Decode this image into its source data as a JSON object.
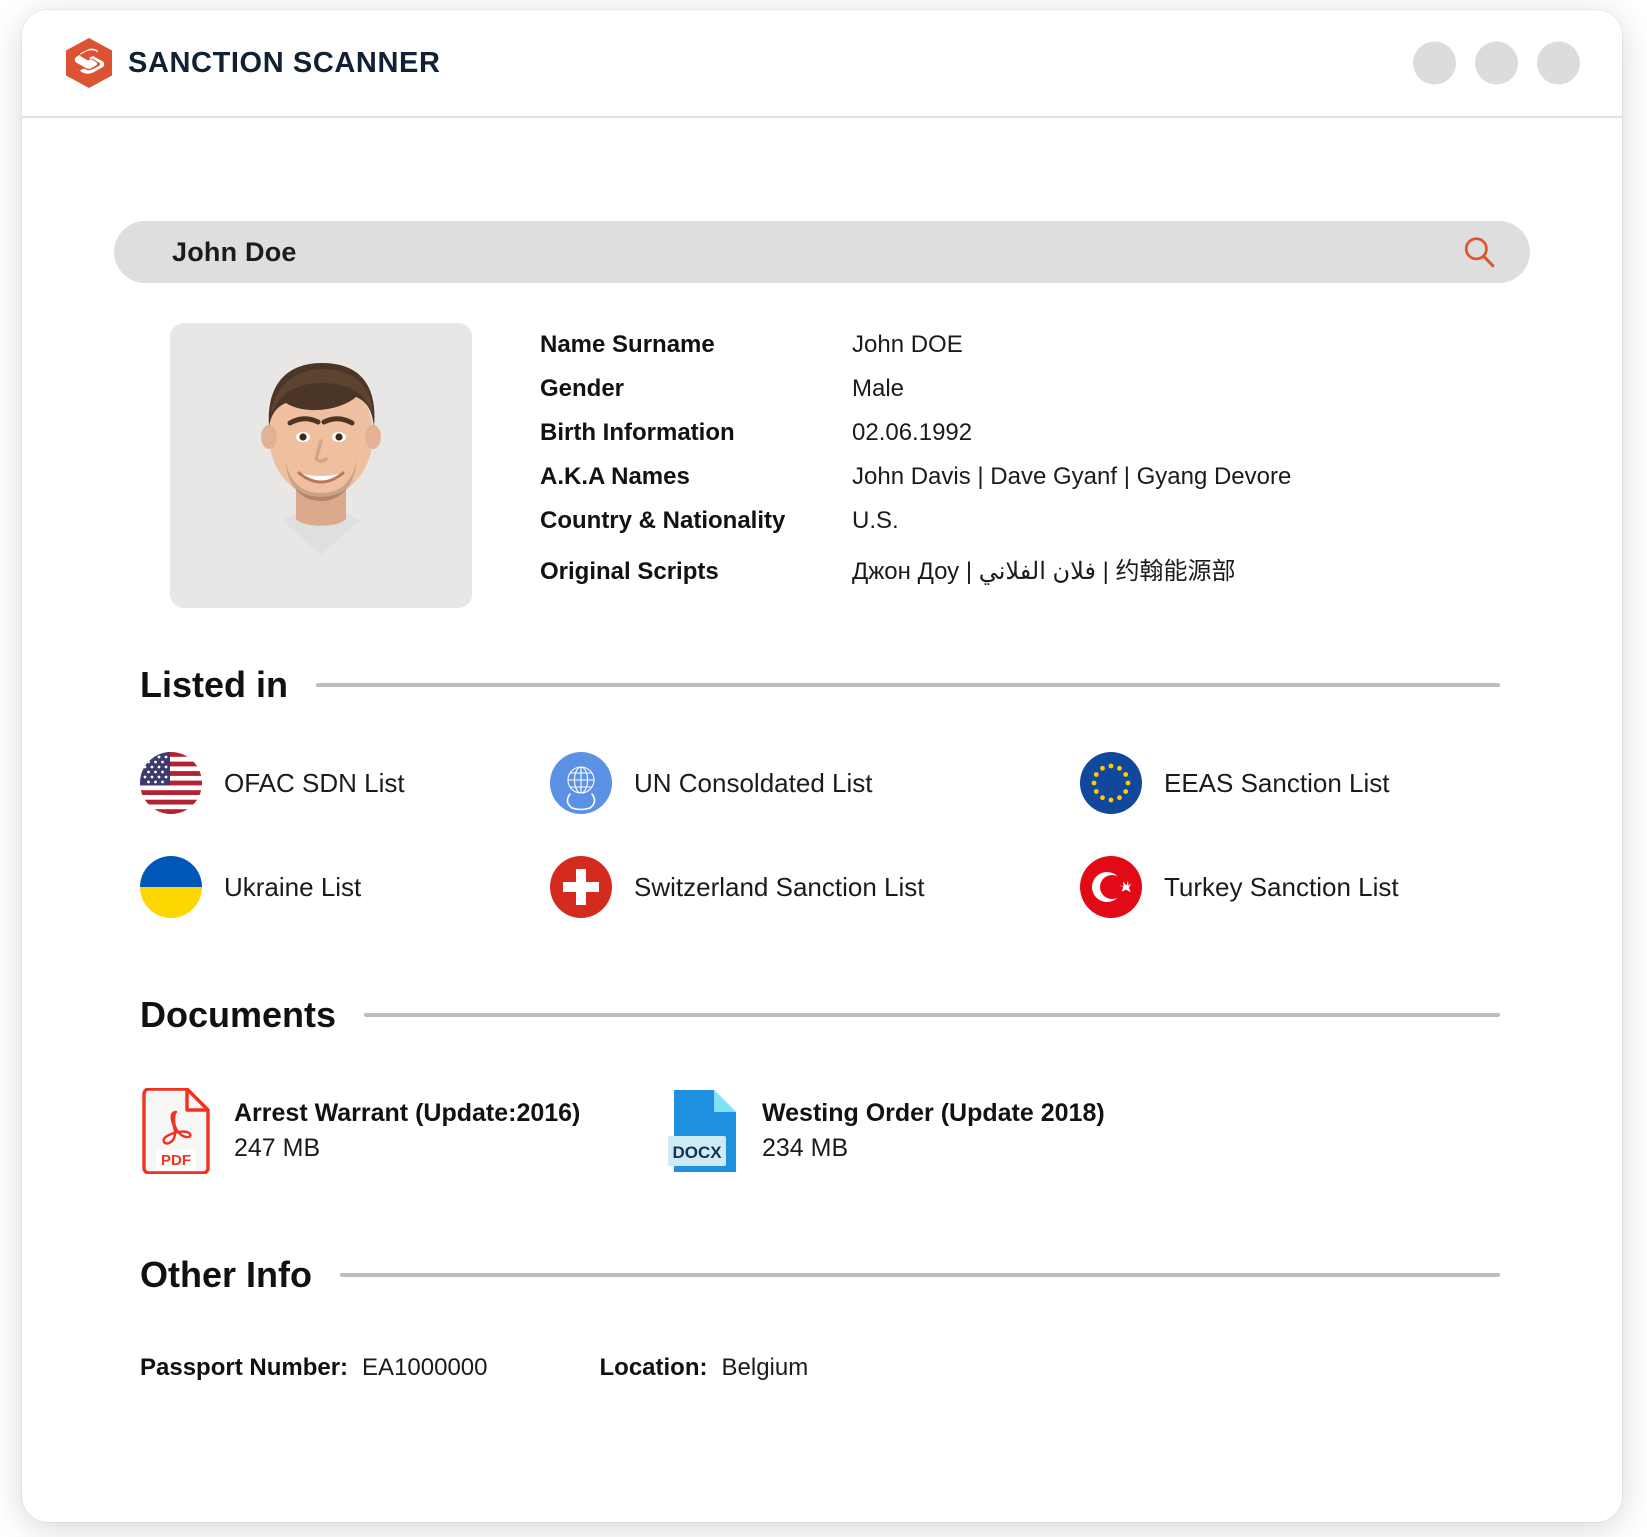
{
  "window": {
    "dots": [
      "window-dot-1",
      "window-dot-2",
      "window-dot-3"
    ]
  },
  "header": {
    "brand_name": "SANCTION SCANNER",
    "logo_icon": "sanction-scanner-hexagon-s-logo",
    "brand_color": "#DC5334",
    "text_color": "#122033"
  },
  "search": {
    "value": "John Doe",
    "placeholder": "John Doe",
    "icon": "search-icon",
    "icon_color": "#E2532C",
    "background": "#DEDEDE"
  },
  "profile": {
    "photo_alt": "profile-photo-john-doe",
    "fields": [
      {
        "label": "Name Surname",
        "value": "John DOE"
      },
      {
        "label": "Gender",
        "value": "Male"
      },
      {
        "label": "Birth Information",
        "value": "02.06.1992"
      },
      {
        "label": "A.K.A Names",
        "value": "John Davis  | Dave Gyanf |  Gyang Devore"
      },
      {
        "label": "Country & Nationality",
        "value": "U.S."
      },
      {
        "label": "Original Scripts",
        "value": "Джон Доу  | فلان الفلاني | 约翰能源部"
      }
    ]
  },
  "listed_in": {
    "title": "Listed in",
    "items": [
      {
        "label": "OFAC SDN List",
        "flag": "us-flag-icon"
      },
      {
        "label": "UN Consoldated List",
        "flag": "un-flag-icon"
      },
      {
        "label": "EEAS Sanction List",
        "flag": "eu-flag-icon"
      },
      {
        "label": "Ukraine List",
        "flag": "ukraine-flag-icon"
      },
      {
        "label": "Switzerland Sanction List",
        "flag": "switzerland-flag-icon"
      },
      {
        "label": "Turkey Sanction List",
        "flag": "turkey-flag-icon"
      }
    ]
  },
  "documents": {
    "title": "Documents",
    "items": [
      {
        "name": "Arrest Warrant (Update:2016)",
        "size": "247 MB",
        "icon": "pdf-file-icon",
        "type": "PDF"
      },
      {
        "name": "Westing Order (Update 2018)",
        "size": "234 MB",
        "icon": "docx-file-icon",
        "type": "DOCX"
      }
    ]
  },
  "other_info": {
    "title": "Other Info",
    "passport_label": "Passport Number:",
    "passport_value": "EA1000000",
    "location_label": "Location:",
    "location_value": "Belgium"
  }
}
